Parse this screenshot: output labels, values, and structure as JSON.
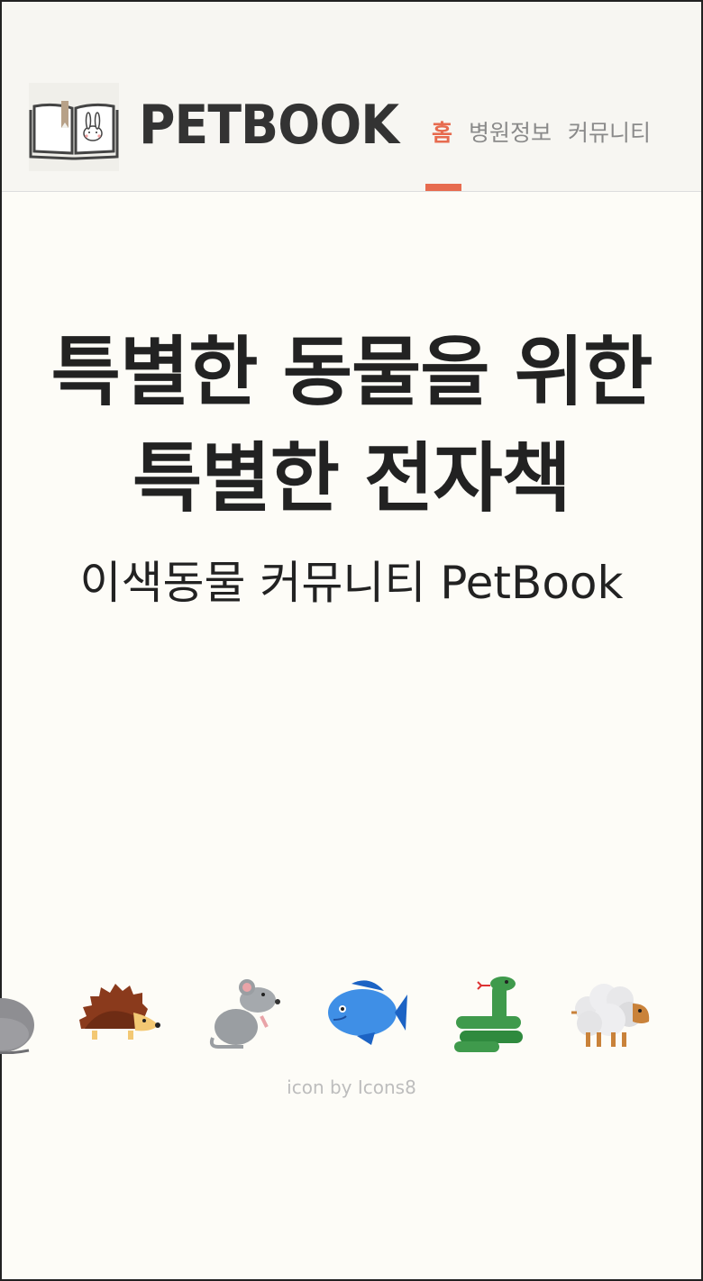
{
  "header": {
    "logo_text": "PETBOOK",
    "nav": [
      {
        "label": "홈",
        "active": true
      },
      {
        "label": "병원정보",
        "active": false
      },
      {
        "label": "커뮤니티",
        "active": false
      }
    ],
    "accent": "#e76b4f"
  },
  "hero": {
    "title_line1": "특별한 동물을 위한",
    "title_line2": "특별한 전자책",
    "subtitle": "이색동물 커뮤니티 PetBook"
  },
  "animals": [
    "rabbit-icon",
    "hedgehog-icon",
    "mouse-icon",
    "fish-icon",
    "snake-icon",
    "sheep-icon"
  ],
  "credit": "icon by Icons8"
}
